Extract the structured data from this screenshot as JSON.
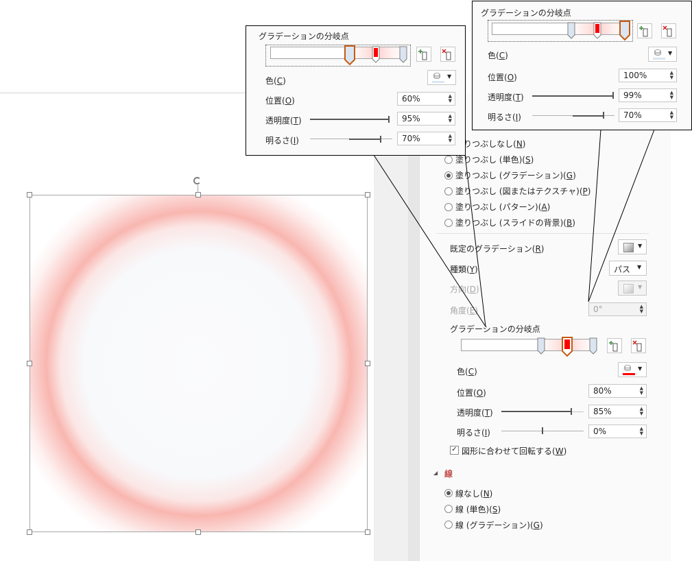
{
  "main_panel": {
    "fill_options": [
      {
        "label": "塗りつぶしなし(",
        "key": "N",
        "selected": false
      },
      {
        "label": "塗りつぶし (単色)(",
        "key": "S",
        "selected": false
      },
      {
        "label": "塗りつぶし (グラデーション)(",
        "key": "G",
        "selected": true
      },
      {
        "label": "塗りつぶし (図またはテクスチャ)(",
        "key": "P",
        "selected": false
      },
      {
        "label": "塗りつぶし (パターン)(",
        "key": "A",
        "selected": false
      },
      {
        "label": "塗りつぶし (スライドの背景)(",
        "key": "B",
        "selected": false
      }
    ],
    "preset": {
      "label": "既定のグラデーション(",
      "key": "R"
    },
    "type": {
      "label": "種類(",
      "key": "Y",
      "value": "パス"
    },
    "direction": {
      "label": "方向(",
      "key": "D"
    },
    "angle": {
      "label": "角度(",
      "key": "E",
      "value": "0°"
    },
    "stops_title": "グラデーションの分岐点",
    "color": {
      "label": "色(",
      "key": "C"
    },
    "position": {
      "label": "位置(",
      "key": "O",
      "value": "80%"
    },
    "transparency": {
      "label": "透明度(",
      "key": "T",
      "value": "85%",
      "level": 85
    },
    "brightness": {
      "label": "明るさ(",
      "key": "I",
      "value": "0%",
      "level": 0
    },
    "rotate": {
      "label": "図形に合わせて回転する(",
      "key": "W",
      "checked": true
    },
    "line_section": "線",
    "line_options": [
      {
        "label": "線なし(",
        "key": "N",
        "selected": true
      },
      {
        "label": "線 (単色)(",
        "key": "S",
        "selected": false
      },
      {
        "label": "線 (グラデーション)(",
        "key": "G",
        "selected": false
      }
    ]
  },
  "callout_left": {
    "title": "グラデーションの分岐点",
    "color": {
      "label": "色(",
      "key": "C"
    },
    "position": {
      "label": "位置(",
      "key": "O",
      "value": "60%"
    },
    "transparency": {
      "label": "透明度(",
      "key": "T",
      "value": "95%",
      "level": 95
    },
    "brightness": {
      "label": "明るさ(",
      "key": "I",
      "value": "70%",
      "level": 70
    }
  },
  "callout_right": {
    "title": "グラデーションの分岐点",
    "color": {
      "label": "色(",
      "key": "C"
    },
    "position": {
      "label": "位置(",
      "key": "O",
      "value": "100%"
    },
    "transparency": {
      "label": "透明度(",
      "key": "T",
      "value": "99%",
      "level": 99
    },
    "brightness": {
      "label": "明るさ(",
      "key": "I",
      "value": "70%",
      "level": 70
    }
  },
  "colors": {
    "accent_orange": "#c55a11",
    "stop_red": "#ff0000",
    "stop_blue": "#dbe5f1",
    "section_header": "#c0504d",
    "ring": "#f4a7a0"
  }
}
